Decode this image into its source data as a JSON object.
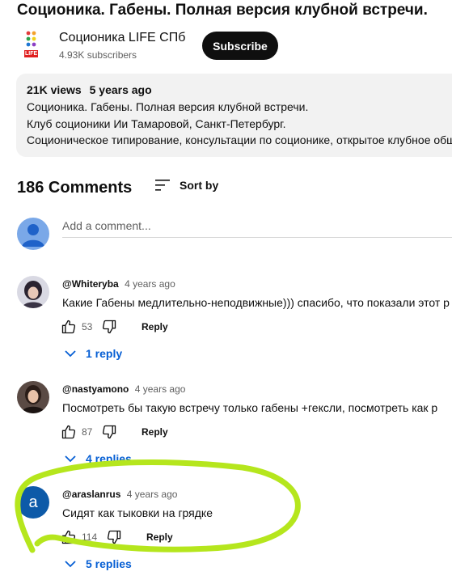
{
  "video": {
    "title": "Соционика. Габены. Полная версия клубной встречи."
  },
  "channel": {
    "name": "Соционика LIFE СПб",
    "subscribers": "4.93K subscribers",
    "subscribe_label": "Subscribe",
    "logo_text": "LIFE"
  },
  "description": {
    "views": "21K views",
    "age": "5 years ago",
    "lines": [
      "Соционика. Габены. Полная версия клубной встречи.",
      "Клуб соционики Ии Тамаровой, Санкт-Петербург.",
      "Соционическое типирование, консультации по соционике, открытое клубное обще"
    ]
  },
  "comments_header": {
    "count": "186 Comments",
    "sort_label": "Sort by"
  },
  "add_comment": {
    "placeholder": "Add a comment..."
  },
  "comments": [
    {
      "author": "@Whiteryba",
      "time": "4 years ago",
      "text": "Какие Габены медлительно-неподвижные))) спасибо, что показали этот р",
      "likes": "53",
      "reply_label": "Reply",
      "replies": "1 reply"
    },
    {
      "author": "@nastyamono",
      "time": "4 years ago",
      "text": "Посмотреть бы такую встречу только габены +гексли,  посмотреть как р",
      "likes": "87",
      "reply_label": "Reply",
      "replies": "4 replies"
    },
    {
      "author": "@araslanrus",
      "time": "4 years ago",
      "text": "Сидят как тыковки на грядке",
      "likes": "114",
      "reply_label": "Reply",
      "replies": "5 replies",
      "avatar_letter": "a"
    }
  ],
  "colors": {
    "accent_link": "#065fd4",
    "highlight": "#b5e61d",
    "subscribe_bg": "#0f0f0f"
  }
}
